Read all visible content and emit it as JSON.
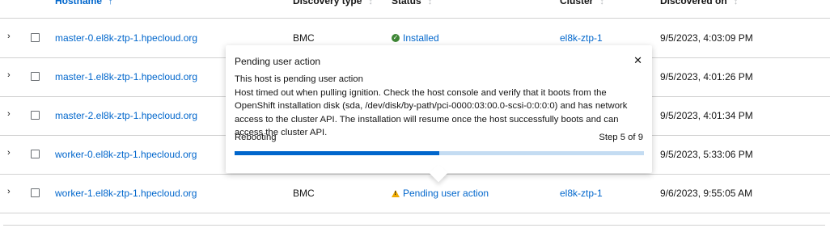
{
  "header": {
    "hostname": "Hostname",
    "discovery_type": "Discovery type",
    "status": "Status",
    "cluster": "Cluster",
    "discovered_on": "Discovered on"
  },
  "rows": [
    {
      "hostname": "master-0.el8k-ztp-1.hpecloud.org",
      "discovery_type": "BMC",
      "status": "Installed",
      "cluster": "el8k-ztp-1",
      "discovered_on": "9/5/2023, 4:03:09 PM"
    },
    {
      "hostname": "master-1.el8k-ztp-1.hpecloud.org",
      "discovery_type": "",
      "status": "",
      "cluster": "",
      "discovered_on": "9/5/2023, 4:01:26 PM"
    },
    {
      "hostname": "master-2.el8k-ztp-1.hpecloud.org",
      "discovery_type": "",
      "status": "",
      "cluster": "",
      "discovered_on": "9/5/2023, 4:01:34 PM"
    },
    {
      "hostname": "worker-0.el8k-ztp-1.hpecloud.org",
      "discovery_type": "",
      "status": "",
      "cluster": "",
      "discovered_on": "9/5/2023, 5:33:06 PM"
    },
    {
      "hostname": "worker-1.el8k-ztp-1.hpecloud.org",
      "discovery_type": "BMC",
      "status": "Pending user action",
      "cluster": "el8k-ztp-1",
      "discovered_on": "9/6/2023, 9:55:05 AM"
    }
  ],
  "popover": {
    "title": "Pending user action",
    "line1": "This host is pending user action",
    "line2": "Host timed out when pulling ignition. Check the host console and verify that it boots from the OpenShift installation disk (sda, /dev/disk/by-path/pci-0000:03:00.0-scsi-0:0:0:0) and has network access to the cluster API. The installation will resume once the host successfully boots and can access the cluster API.",
    "progress_label": "Rebooting",
    "step_text": "Step 5 of 9",
    "progress_fraction": 0.5
  },
  "colors": {
    "link": "#0066cc",
    "success": "#3e8635",
    "warning": "#f0ab00",
    "progress_fill": "#0066cc",
    "progress_track": "#c4dcf2"
  }
}
